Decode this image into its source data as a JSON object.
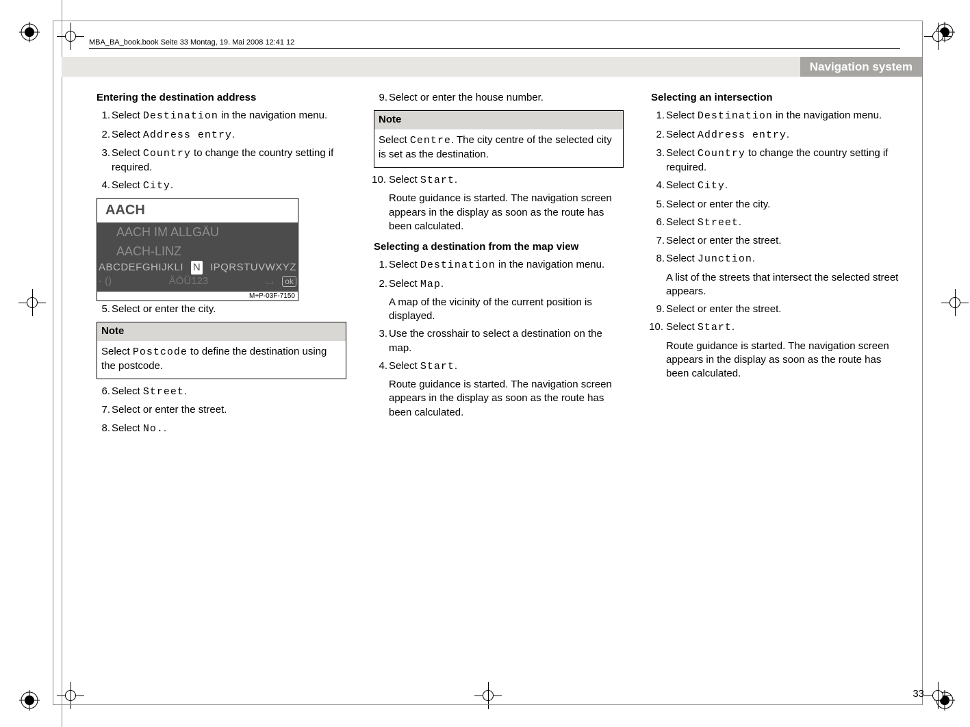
{
  "runhead": "MBA_BA_book.book  Seite 33  Montag, 19. Mai 2008  12:41 12",
  "header_title": "Navigation system",
  "page_number": "33",
  "col1": {
    "heading": "Entering the destination address",
    "items": {
      "n1": "1.",
      "t1a": "Select ",
      "t1b": "Destination",
      "t1c": " in the navigation menu.",
      "n2": "2.",
      "t2a": "Select ",
      "t2b": "Address entry",
      "t2c": ".",
      "n3": "3.",
      "t3a": "Select ",
      "t3b": "Country",
      "t3c": " to change the country setting if required.",
      "n4": "4.",
      "t4a": "Select ",
      "t4b": "City",
      "t4c": "."
    },
    "screen": {
      "sel": "AACH",
      "opt1": "AACH IM ALLGÄU",
      "opt2": "AACH-LINZ",
      "alphaL": "ABCDEFGHIJKLI",
      "alphaN": "N",
      "alphaR": "IPQRSTUVWXYZ",
      "row2L": "- ()",
      "row2M": "ÄÖÜ123",
      "row2spc": "⌴",
      "row2ok": "ok",
      "caption": "M+P-03F-7150"
    },
    "after": {
      "n5": "5.",
      "t5": "Select or enter the city."
    },
    "note": {
      "hd": "Note",
      "body_a": "Select ",
      "body_b": "Postcode",
      "body_c": " to define the destination using the postcode."
    },
    "after2": {
      "n6": "6.",
      "t6a": "Select ",
      "t6b": "Street",
      "t6c": ".",
      "n7": "7.",
      "t7": "Select or enter the street.",
      "n8": "8.",
      "t8a": "Select ",
      "t8b": "No.",
      "t8c": "."
    }
  },
  "col2": {
    "items1": {
      "n9": "9.",
      "t9": "Select or enter the house number."
    },
    "note": {
      "hd": "Note",
      "body_a": "Select ",
      "body_b": "Centre",
      "body_c": ". The city centre of the selected city is set as the destination."
    },
    "items2": {
      "n10": "10.",
      "t10a": "Select ",
      "t10b": "Start",
      "t10c": ".",
      "t10d": "Route guidance is started. The navigation screen appears in the display as soon as the route has been calculated."
    },
    "heading2": "Selecting a destination from the map view",
    "items3": {
      "n1": "1.",
      "t1a": "Select ",
      "t1b": "Destination",
      "t1c": " in the navigation menu.",
      "n2": "2.",
      "t2a": "Select ",
      "t2b": "Map",
      "t2c": ".",
      "t2d": "A map of the vicinity of the current position is displayed.",
      "n3": "3.",
      "t3": "Use the crosshair to select a destination on the map.",
      "n4": "4.",
      "t4a": "Select ",
      "t4b": "Start",
      "t4c": ".",
      "t4d": "Route guidance is started. The navigation screen appears in the display as soon as the route has been calculated."
    }
  },
  "col3": {
    "heading": "Selecting an intersection",
    "items": {
      "n1": "1.",
      "t1a": "Select ",
      "t1b": "Destination",
      "t1c": " in the navigation menu.",
      "n2": "2.",
      "t2a": "Select ",
      "t2b": "Address entry",
      "t2c": ".",
      "n3": "3.",
      "t3a": "Select ",
      "t3b": "Country",
      "t3c": " to change the country setting if required.",
      "n4": "4.",
      "t4a": "Select ",
      "t4b": "City",
      "t4c": ".",
      "n5": "5.",
      "t5": "Select or enter the city.",
      "n6": "6.",
      "t6a": "Select ",
      "t6b": "Street",
      "t6c": ".",
      "n7": "7.",
      "t7": "Select or enter the street.",
      "n8": "8.",
      "t8a": "Select ",
      "t8b": "Junction",
      "t8c": ".",
      "t8d": "A list of the streets that intersect the selected street appears.",
      "n9": "9.",
      "t9": "Select or enter the street.",
      "n10": "10.",
      "t10a": "Select ",
      "t10b": "Start",
      "t10c": ".",
      "t10d": "Route guidance is started. The navigation screen appears in the display as soon as the route has been calculated."
    }
  }
}
